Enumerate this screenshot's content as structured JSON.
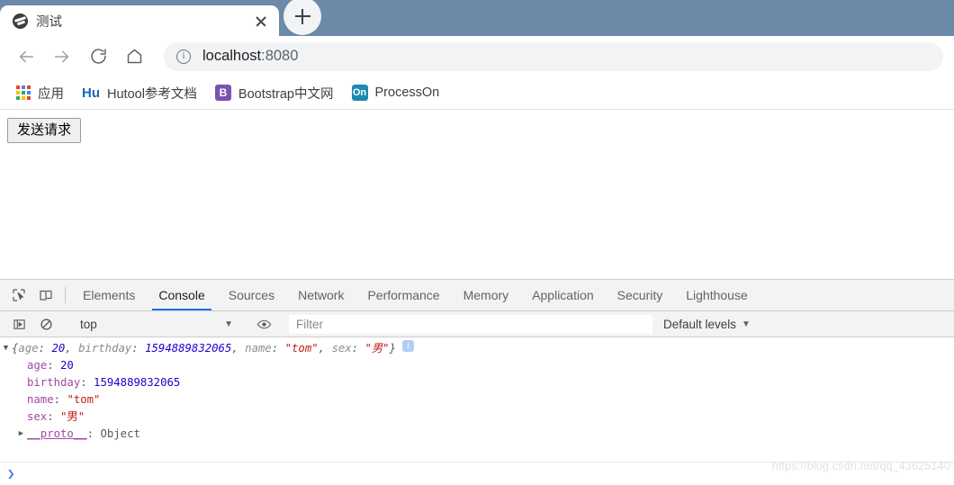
{
  "browser": {
    "tab": {
      "title": "测试",
      "favicon": "globe-icon",
      "close": "×"
    },
    "new_tab_label": "+",
    "nav": {
      "back": "back-arrow-icon",
      "forward": "forward-arrow-icon",
      "reload": "reload-icon",
      "home": "home-icon"
    },
    "omnibox": {
      "host": "localhost",
      "port": ":8080",
      "security_icon": "info-circle-icon"
    },
    "bookmarks": [
      {
        "label": "应用",
        "icon": "apps-grid-icon"
      },
      {
        "label": "Hutool参考文档",
        "icon": "hu-icon",
        "icon_text": "Hu",
        "color": "#1668b8"
      },
      {
        "label": "Bootstrap中文网",
        "icon": "bootstrap-icon",
        "icon_text": "B",
        "color": "#7952b3"
      },
      {
        "label": "ProcessOn",
        "icon": "processon-icon",
        "icon_text": "On",
        "color": "#1b8ab0"
      }
    ]
  },
  "page": {
    "button_label": "发送请求"
  },
  "devtools": {
    "left_icons": [
      {
        "name": "inspect-element-icon"
      },
      {
        "name": "device-toolbar-icon"
      }
    ],
    "tabs": [
      {
        "label": "Elements",
        "active": false
      },
      {
        "label": "Console",
        "active": true
      },
      {
        "label": "Sources",
        "active": false
      },
      {
        "label": "Network",
        "active": false
      },
      {
        "label": "Performance",
        "active": false
      },
      {
        "label": "Memory",
        "active": false
      },
      {
        "label": "Application",
        "active": false
      },
      {
        "label": "Security",
        "active": false
      },
      {
        "label": "Lighthouse",
        "active": false
      }
    ],
    "toolbar": {
      "sidebar_icon": "console-sidebar-icon",
      "clear_icon": "clear-console-icon",
      "context": "top",
      "context_caret": "▼",
      "eye_icon": "live-expression-eye-icon",
      "filter_placeholder": "Filter",
      "filter_value": "",
      "levels_label": "Default levels",
      "levels_caret": "▼"
    },
    "console": {
      "summary": {
        "arrow": "▼",
        "open_brace": "{",
        "close_brace": "}",
        "entries": [
          {
            "key": "age",
            "value": "20",
            "type": "number"
          },
          {
            "key": "birthday",
            "value": "1594889832065",
            "type": "number"
          },
          {
            "key": "name",
            "value": "\"tom\"",
            "type": "string"
          },
          {
            "key": "sex",
            "value": "\"男\"",
            "type": "string"
          }
        ],
        "info_badge": "i"
      },
      "properties": [
        {
          "key": "age",
          "value": "20",
          "type": "number"
        },
        {
          "key": "birthday",
          "value": "1594889832065",
          "type": "number"
        },
        {
          "key": "name",
          "value": "\"tom\"",
          "type": "string"
        },
        {
          "key": "sex",
          "value": "\"男\"",
          "type": "string"
        }
      ],
      "proto": {
        "arrow": "▶",
        "key": "__proto__",
        "value": "Object"
      },
      "prompt_caret": "❯"
    },
    "watermark": "https://blog.csdn.net/qq_43625140"
  }
}
